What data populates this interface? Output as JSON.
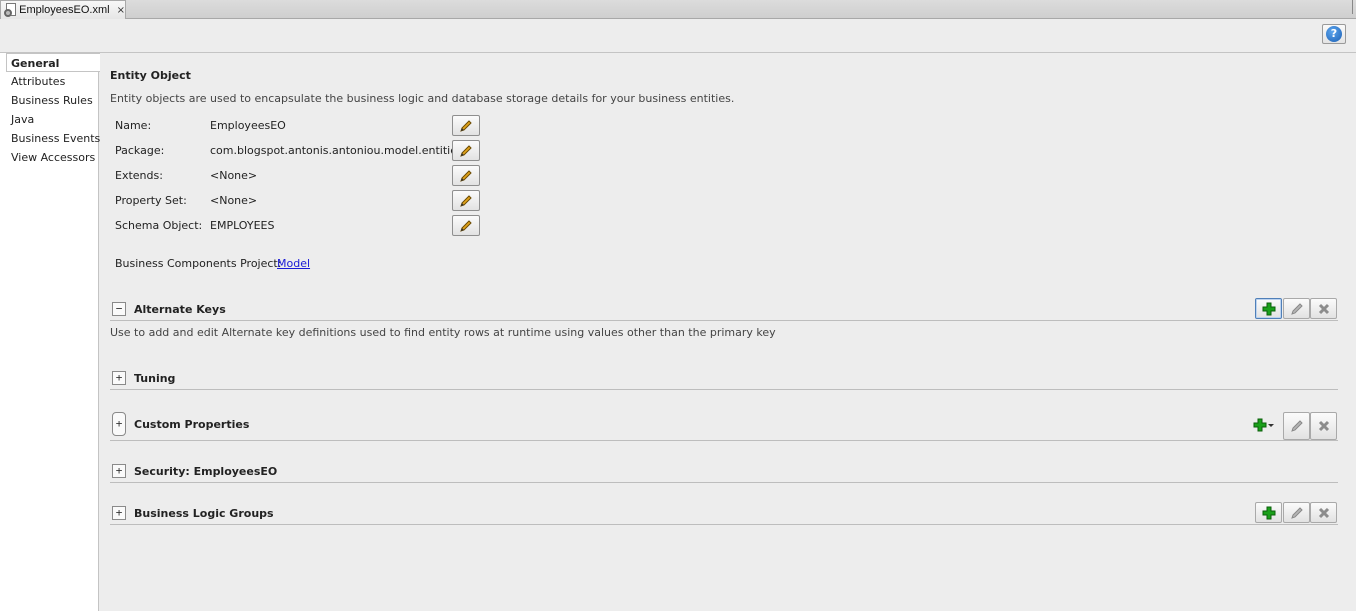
{
  "tab": {
    "title": "EmployeesEO.xml",
    "close": "×"
  },
  "help": {
    "label": "?"
  },
  "nav": {
    "items": [
      {
        "label": "General"
      },
      {
        "label": "Attributes"
      },
      {
        "label": "Business Rules"
      },
      {
        "label": "Java"
      },
      {
        "label": "Business Events"
      },
      {
        "label": "View Accessors"
      }
    ]
  },
  "entity": {
    "title": "Entity Object",
    "description": "Entity objects are used to encapsulate the business logic and database storage details for your business entities.",
    "fields": [
      {
        "label": "Name:",
        "value": "EmployeesEO"
      },
      {
        "label": "Package:",
        "value": "com.blogspot.antonis.antoniou.model.entities"
      },
      {
        "label": "Extends:",
        "value": "<None>"
      },
      {
        "label": "Property Set:",
        "value": "<None>"
      },
      {
        "label": "Schema Object:",
        "value": "EMPLOYEES"
      }
    ],
    "project_label": "Business Components Project:",
    "project_link": "Model"
  },
  "sections": {
    "alternate_keys": {
      "expander": "−",
      "title": "Alternate Keys",
      "description": "Use to add and edit Alternate key definitions used to find entity rows at runtime using values other than the primary key"
    },
    "tuning": {
      "expander": "+",
      "title": "Tuning"
    },
    "custom_properties": {
      "expander": "+",
      "title": "Custom Properties"
    },
    "security": {
      "expander": "+",
      "title": "Security: EmployeesEO"
    },
    "business_logic_groups": {
      "expander": "+",
      "title": "Business Logic Groups"
    }
  },
  "icons": {
    "add": "plus-icon",
    "edit": "pencil-icon",
    "delete": "delete-x-icon",
    "help": "help-icon",
    "add_color": "#1aa01a",
    "pencil_color": "#e0a21a"
  }
}
